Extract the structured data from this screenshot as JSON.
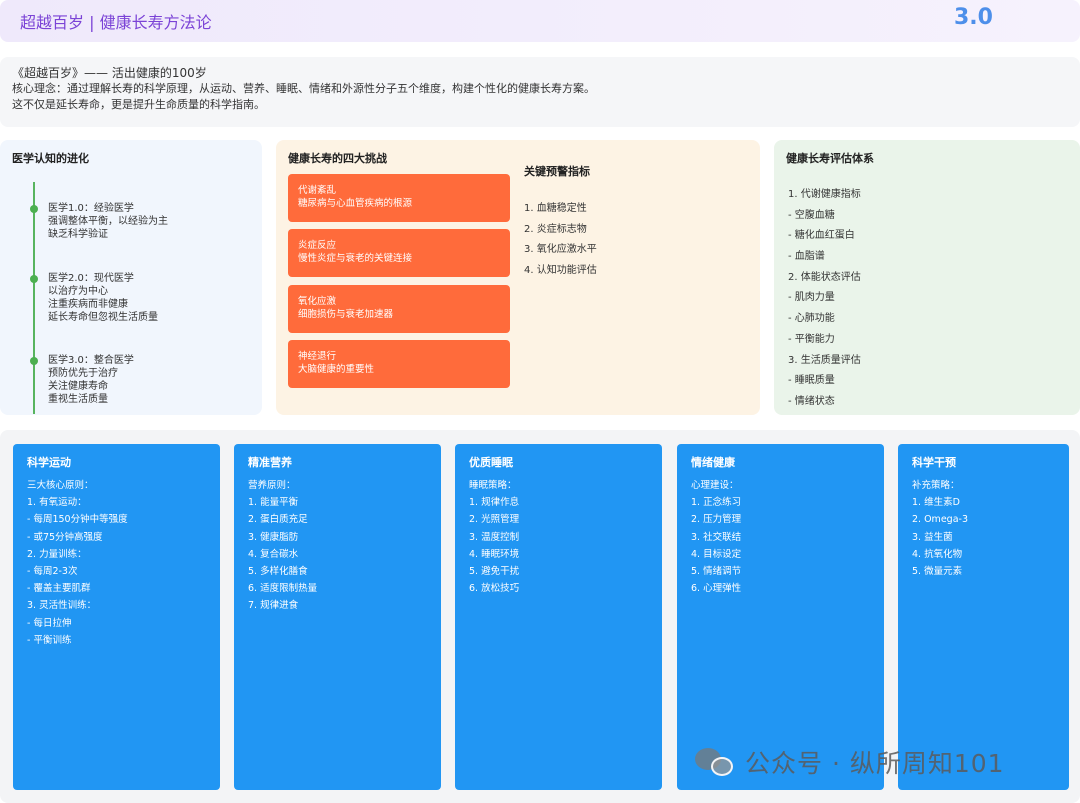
{
  "header": {
    "title": "超越百岁 | 健康长寿方法论",
    "version": "3.0"
  },
  "intro": {
    "title": "《超越百岁》—— 活出健康的100岁",
    "line1": "核心理念：通过理解长寿的科学原理，从运动、营养、睡眠、情绪和外源性分子五个维度，构建个性化的健康长寿方案。",
    "line2": "这不仅是延长寿命，更是提升生命质量的科学指南。"
  },
  "medical": {
    "title": "医学认知的进化",
    "items": [
      {
        "lines": [
          "医学1.0：经验医学",
          "强调整体平衡，以经验为主",
          "缺乏科学验证"
        ]
      },
      {
        "lines": [
          "医学2.0：现代医学",
          "以治疗为中心",
          "注重疾病而非健康",
          "延长寿命但忽视生活质量"
        ]
      },
      {
        "lines": [
          "医学3.0：整合医学",
          "预防优先于治疗",
          "关注健康寿命",
          "重视生活质量"
        ]
      }
    ]
  },
  "challenges": {
    "title": "健康长寿的四大挑战",
    "cards": [
      {
        "name": "代谢紊乱",
        "desc": "糖尿病与心血管疾病的根源"
      },
      {
        "name": "炎症反应",
        "desc": "慢性炎症与衰老的关键连接"
      },
      {
        "name": "氧化应激",
        "desc": "细胞损伤与衰老加速器"
      },
      {
        "name": "神经退行",
        "desc": "大脑健康的重要性"
      }
    ],
    "warning_title": "关键预警指标",
    "warnings": [
      "1. 血糖稳定性",
      "2. 炎症标志物",
      "3. 氧化应激水平",
      "4. 认知功能评估"
    ]
  },
  "evaluation": {
    "title": "健康长寿评估体系",
    "items": [
      "1. 代谢健康指标",
      "- 空腹血糖",
      "- 糖化血红蛋白",
      "- 血脂谱",
      "2. 体能状态评估",
      "- 肌肉力量",
      "- 心肺功能",
      "- 平衡能力",
      "3. 生活质量评估",
      "- 睡眠质量",
      "- 情绪状态"
    ]
  },
  "pillars": [
    {
      "title": "科学运动",
      "lines": [
        "三大核心原则：",
        "1. 有氧运动：",
        "- 每周150分钟中等强度",
        "- 或75分钟高强度",
        "2. 力量训练：",
        "- 每周2-3次",
        "- 覆盖主要肌群",
        "3. 灵活性训练：",
        "- 每日拉伸",
        "- 平衡训练"
      ]
    },
    {
      "title": "精准营养",
      "lines": [
        "营养原则：",
        "1. 能量平衡",
        "2. 蛋白质充足",
        "3. 健康脂肪",
        "4. 复合碳水",
        "5. 多样化膳食",
        "6. 适度限制热量",
        "7. 规律进食"
      ]
    },
    {
      "title": "优质睡眠",
      "lines": [
        "睡眠策略：",
        "1. 规律作息",
        "2. 光照管理",
        "3. 温度控制",
        "4. 睡眠环境",
        "5. 避免干扰",
        "6. 放松技巧"
      ]
    },
    {
      "title": "情绪健康",
      "lines": [
        "心理建设：",
        "1. 正念练习",
        "2. 压力管理",
        "3. 社交联结",
        "4. 目标设定",
        "5. 情绪调节",
        "6. 心理弹性"
      ]
    },
    {
      "title": "科学干预",
      "lines": [
        "补充策略：",
        "1. 维生素D",
        "2. Omega-3",
        "3. 益生菌",
        "4. 抗氧化物",
        "5. 微量元素"
      ]
    }
  ],
  "watermark": {
    "text": "公众号 · 纵所周知101"
  }
}
